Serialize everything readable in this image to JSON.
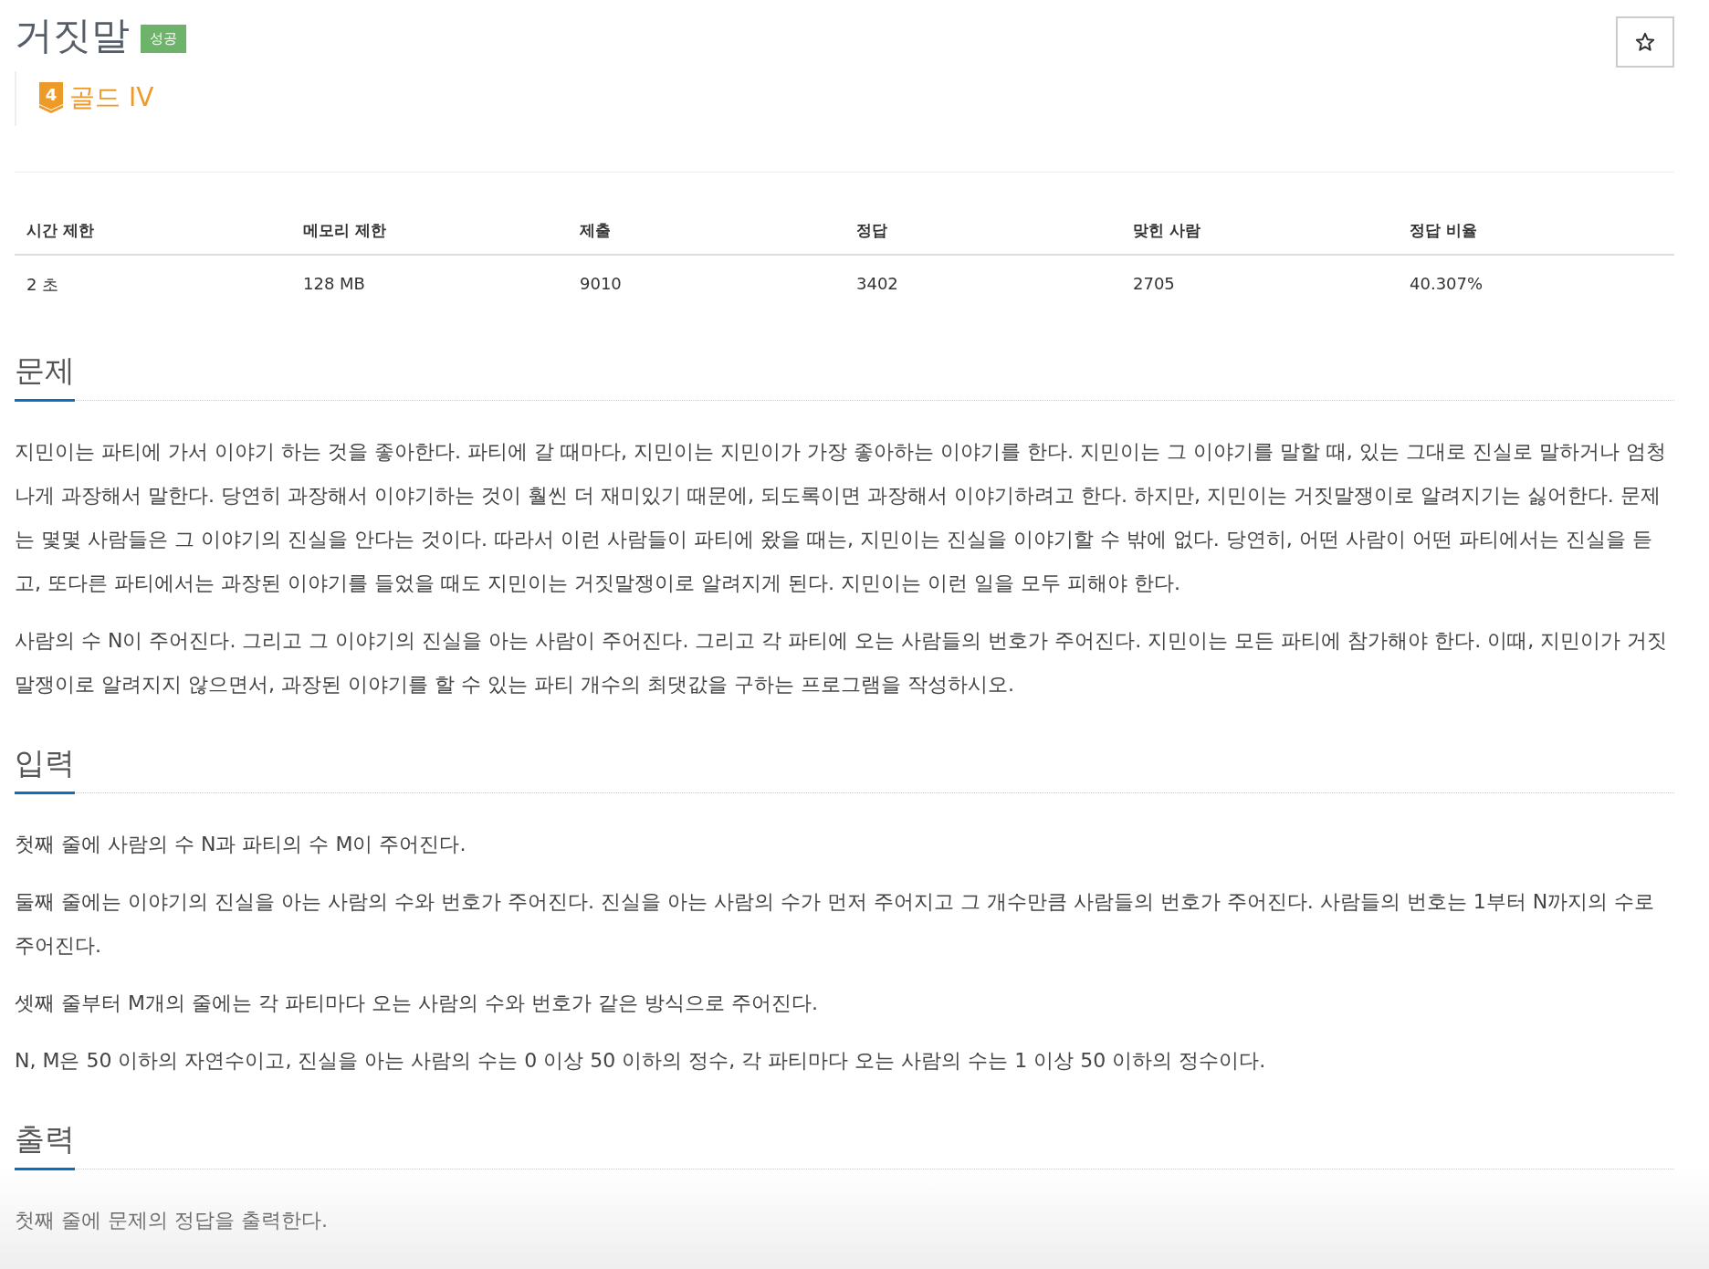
{
  "title": "거짓말",
  "result_badge": "성공",
  "favorite": {
    "starred": false
  },
  "tier": {
    "number": "4",
    "label": "골드 IV",
    "color": "#ec9a29"
  },
  "stats": {
    "columns": [
      "시간 제한",
      "메모리 제한",
      "제출",
      "정답",
      "맞힌 사람",
      "정답 비율"
    ],
    "values": [
      "2 초",
      "128 MB",
      "9010",
      "3402",
      "2705",
      "40.307%"
    ]
  },
  "sections": [
    {
      "heading": "문제",
      "paragraphs": [
        "지민이는 파티에 가서 이야기 하는 것을 좋아한다. 파티에 갈 때마다, 지민이는 지민이가 가장 좋아하는 이야기를 한다. 지민이는 그 이야기를 말할 때, 있는 그대로 진실로 말하거나 엄청나게 과장해서 말한다. 당연히 과장해서 이야기하는 것이 훨씬 더 재미있기 때문에, 되도록이면 과장해서 이야기하려고 한다. 하지만, 지민이는 거짓말쟁이로 알려지기는 싫어한다. 문제는 몇몇 사람들은 그 이야기의 진실을 안다는 것이다. 따라서 이런 사람들이 파티에 왔을 때는, 지민이는 진실을 이야기할 수 밖에 없다. 당연히, 어떤 사람이 어떤 파티에서는 진실을 듣고, 또다른 파티에서는 과장된 이야기를 들었을 때도 지민이는 거짓말쟁이로 알려지게 된다. 지민이는 이런 일을 모두 피해야 한다.",
        "사람의 수 N이 주어진다. 그리고 그 이야기의 진실을 아는 사람이 주어진다. 그리고 각 파티에 오는 사람들의 번호가 주어진다. 지민이는 모든 파티에 참가해야 한다. 이때, 지민이가 거짓말쟁이로 알려지지 않으면서, 과장된 이야기를 할 수 있는 파티 개수의 최댓값을 구하는 프로그램을 작성하시오."
      ]
    },
    {
      "heading": "입력",
      "paragraphs": [
        "첫째 줄에 사람의 수 N과 파티의 수 M이 주어진다.",
        "둘째 줄에는 이야기의 진실을 아는 사람의 수와 번호가 주어진다. 진실을 아는 사람의 수가 먼저 주어지고 그 개수만큼 사람들의 번호가 주어진다. 사람들의 번호는 1부터 N까지의 수로 주어진다.",
        "셋째 줄부터 M개의 줄에는 각 파티마다 오는 사람의 수와 번호가 같은 방식으로 주어진다.",
        "N, M은 50 이하의 자연수이고, 진실을 아는 사람의 수는 0 이상 50 이하의 정수, 각 파티마다 오는 사람의 수는 1 이상 50 이하의 정수이다."
      ]
    },
    {
      "heading": "출력",
      "paragraphs": [
        "첫째 줄에 문제의 정답을 출력한다."
      ]
    }
  ]
}
